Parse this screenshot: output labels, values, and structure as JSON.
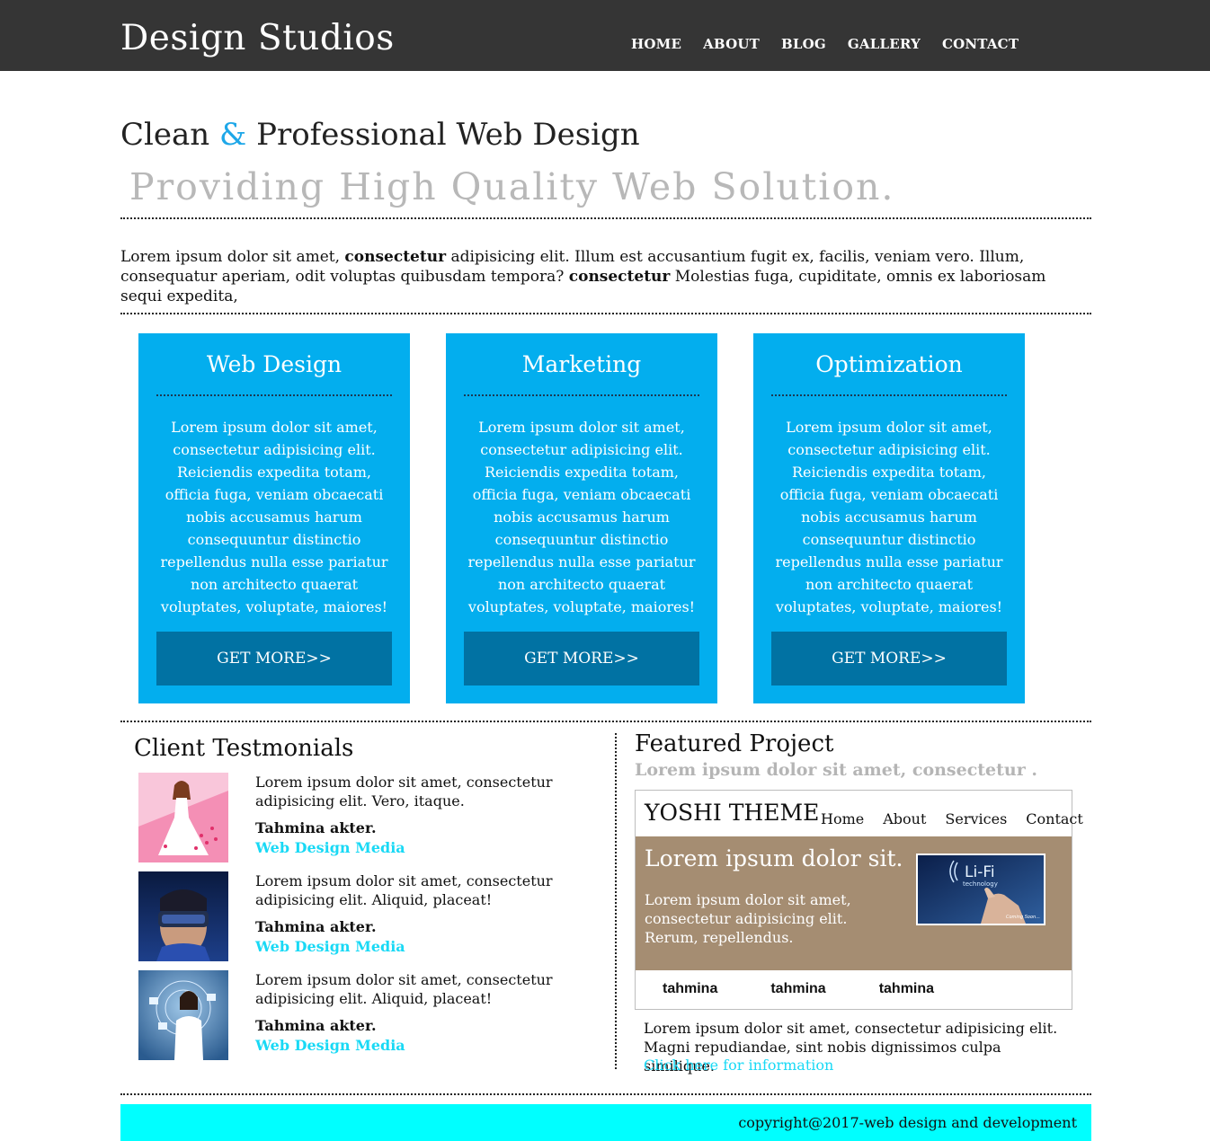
{
  "header": {
    "logo": "Design Studios",
    "nav": [
      "HOME",
      "ABOUT",
      "BLOG",
      "GALLERY",
      "CONTACT"
    ]
  },
  "hero": {
    "title_part1": "Clean ",
    "title_amp": "&",
    "title_part2": " Professional Web Design",
    "subtitle": "Providing High Quality Web Solution.",
    "accent_color": "#1ea7e8"
  },
  "intro": {
    "t1": "Lorem ipsum dolor sit amet, ",
    "b1": "consectetur",
    "t2": " adipisicing elit. Illum est accusantium fugit ex, facilis, veniam vero. Illum, consequatur aperiam, odit voluptas quibusdam tempora? ",
    "b2": "consectetur",
    "t3": " Molestias fuga, cupiditate, omnis ex laboriosam sequi expedita,"
  },
  "services": [
    {
      "title": "Web Design",
      "body": "Lorem ipsum dolor sit amet, consectetur adipisicing elit. Reiciendis expedita totam, officia fuga, veniam obcaecati nobis accusamus harum consequuntur distinctio repellendus nulla esse pariatur non architecto quaerat voluptates, voluptate, maiores!",
      "button": "GET MORE>>"
    },
    {
      "title": "Marketing",
      "body": "Lorem ipsum dolor sit amet, consectetur adipisicing elit. Reiciendis expedita totam, officia fuga, veniam obcaecati nobis accusamus harum consequuntur distinctio repellendus nulla esse pariatur non architecto quaerat voluptates, voluptate, maiores!",
      "button": "GET MORE>>"
    },
    {
      "title": "Optimization",
      "body": "Lorem ipsum dolor sit amet, consectetur adipisicing elit. Reiciendis expedita totam, officia fuga, veniam obcaecati nobis accusamus harum consequuntur distinctio repellendus nulla esse pariatur non architecto quaerat voluptates, voluptate, maiores!",
      "button": "GET MORE>>"
    }
  ],
  "testimonials": {
    "title": "Client Testmonials",
    "items": [
      {
        "text": "Lorem ipsum dolor sit amet, consectetur adipisicing elit. Vero, itaque.",
        "name": "Tahmina akter.",
        "org": "Web Design Media"
      },
      {
        "text": "Lorem ipsum dolor sit amet, consectetur adipisicing elit. Aliquid, placeat!",
        "name": "Tahmina akter.",
        "org": "Web Design Media"
      },
      {
        "text": "Lorem ipsum dolor sit amet, consectetur adipisicing elit. Aliquid, placeat!",
        "name": "Tahmina akter.",
        "org": "Web Design Media"
      }
    ]
  },
  "featured": {
    "title": "Featured Project",
    "subtitle": "Lorem ipsum dolor sit amet, consectetur .",
    "preview": {
      "brand": "YOSHI THEME",
      "nav": [
        "Home",
        "About",
        "Services",
        "Contact"
      ],
      "banner_title": "Lorem ipsum dolor sit.",
      "banner_text": "Lorem ipsum dolor sit amet, consectetur adipisicing elit. Rerum, repellendus.",
      "thumb_title": "Li-Fi",
      "thumb_sub": "technology",
      "thumb_note": "Coming Soon...",
      "tabs": [
        "tahmina",
        "tahmina",
        "tahmina"
      ]
    },
    "description": "Lorem ipsum dolor sit amet, consectetur adipisicing elit. Magni repudiandae, sint nobis dignissimos culpa similique.",
    "link": "Click here for information"
  },
  "footer": {
    "copyright": "copyright@2017-web design and development"
  },
  "colors": {
    "topbar": "#353535",
    "card": "#03aeee",
    "card_button": "#0172a3",
    "link": "#19d9f5",
    "banner": "#a58d72",
    "footer": "#00ffff"
  }
}
